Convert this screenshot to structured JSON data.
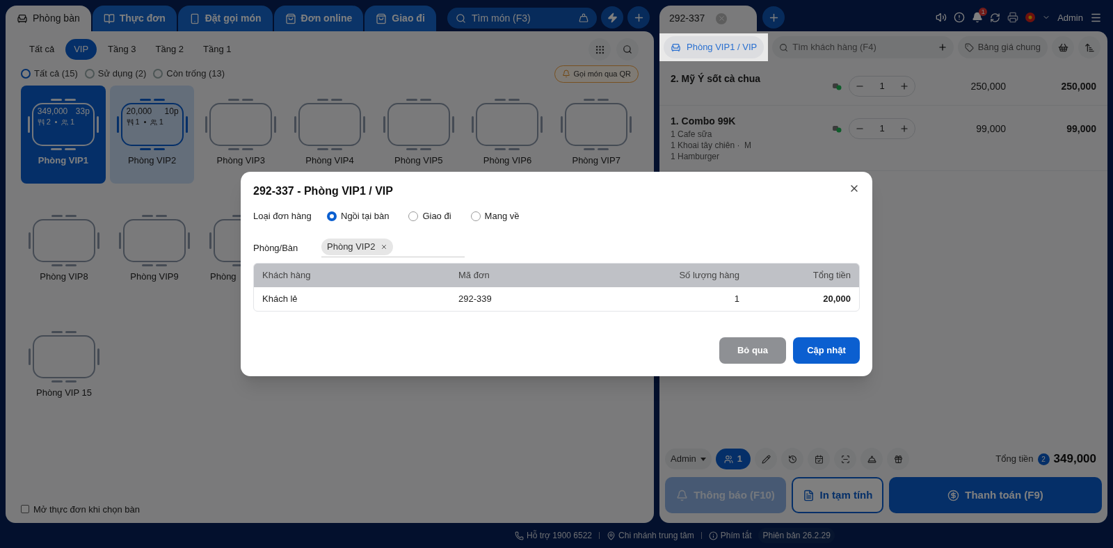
{
  "main_tabs": [
    {
      "label": "Phòng bàn",
      "selected": true
    },
    {
      "label": "Thực đơn",
      "selected": false
    },
    {
      "label": "Đặt gọi món",
      "selected": false
    },
    {
      "label": "Đơn online",
      "selected": false
    },
    {
      "label": "Giao đi",
      "selected": false
    }
  ],
  "search": {
    "placeholder": "Tìm món (F3)"
  },
  "area_filters": [
    {
      "label": "Tất cả",
      "selected": false
    },
    {
      "label": "VIP",
      "selected": true
    },
    {
      "label": "Tầng 3",
      "selected": false
    },
    {
      "label": "Tầng 2",
      "selected": false
    },
    {
      "label": "Tầng 1",
      "selected": false
    }
  ],
  "status_filters": [
    {
      "label": "Tất cả (15)",
      "selected": true
    },
    {
      "label": "Sử dụng (2)",
      "selected": false
    },
    {
      "label": "Còn trống (13)",
      "selected": false
    }
  ],
  "qr_button": "Gọi món qua QR",
  "table_rows": [
    [
      {
        "name": "Phòng VIP1",
        "kind": "current",
        "amount": "349,000",
        "time": "33p",
        "dishes": "2",
        "guests": "1"
      },
      {
        "name": "Phòng VIP2",
        "kind": "occupied",
        "amount": "20,000",
        "time": "10p",
        "dishes": "1",
        "guests": "1"
      },
      {
        "name": "Phòng VIP3",
        "kind": "empty"
      },
      {
        "name": "Phòng VIP4",
        "kind": "empty"
      },
      {
        "name": "Phòng VIP5",
        "kind": "empty"
      },
      {
        "name": "Phòng VIP6",
        "kind": "empty"
      },
      {
        "name": "Phòng VIP7",
        "kind": "empty"
      }
    ],
    [
      {
        "name": "Phòng VIP8",
        "kind": "empty"
      },
      {
        "name": "Phòng VIP9",
        "kind": "empty"
      },
      {
        "name": "Phòng",
        "kind": "empty"
      }
    ],
    [
      {
        "name": "Phòng VIP 15",
        "kind": "empty"
      }
    ]
  ],
  "open_menu_option": {
    "label": "Mở thực đơn khi chọn bàn",
    "checked": false
  },
  "order_tab": {
    "label": "292-337"
  },
  "notification_count": "1",
  "user": "Admin",
  "room_button": "Phòng VIP1 / VIP",
  "customer_search": {
    "placeholder": "Tìm khách hàng (F4)"
  },
  "price_list": "Bảng giá chung",
  "order_items": [
    {
      "name": "2. Mỹ Ý sốt cà chua",
      "quantity": "1",
      "price": "250,000",
      "total": "250,000"
    },
    {
      "name": "1. Combo 99K",
      "details": [
        "1 Cafe sữa",
        "1 Khoai tây chiên ·  M",
        "1 Hamburger"
      ],
      "quantity": "1",
      "price": "99,000",
      "total": "99,000"
    }
  ],
  "summary": {
    "staff": "Admin",
    "guest_count": "1",
    "total_label": "Tổng tiền",
    "item_count": "2",
    "total": "349,000"
  },
  "actions": [
    {
      "label": "Thông báo (F10)",
      "kind": "notify"
    },
    {
      "label": "In tạm tính",
      "kind": "print"
    },
    {
      "label": "Thanh toán (F9)",
      "kind": "pay"
    }
  ],
  "status_bar": {
    "support": "Hỗ trợ 1900 6522",
    "branch": "Chi nhánh trung tâm",
    "shortcuts": "Phím tắt",
    "version": "Phiên bản 26.2.29"
  },
  "dialog": {
    "title": "292-337 - Phòng VIP1 / VIP",
    "order_type_label": "Loại đơn hàng",
    "order_types": [
      {
        "label": "Ngồi tại bàn",
        "selected": true
      },
      {
        "label": "Giao đi",
        "selected": false
      },
      {
        "label": "Mang về",
        "selected": false
      }
    ],
    "room_label": "Phòng/Bàn",
    "room_tags": [
      "Phòng VIP2"
    ],
    "table": {
      "columns": [
        "Khách hàng",
        "Mã đơn",
        "Số lượng hàng",
        "Tổng tiền"
      ],
      "rows": [
        [
          "Khách lẻ",
          "292-339",
          "1",
          "20,000"
        ]
      ]
    },
    "buttons": [
      {
        "label": "Bỏ qua",
        "kind": "secondary"
      },
      {
        "label": "Cập nhật",
        "kind": "primary"
      }
    ]
  }
}
